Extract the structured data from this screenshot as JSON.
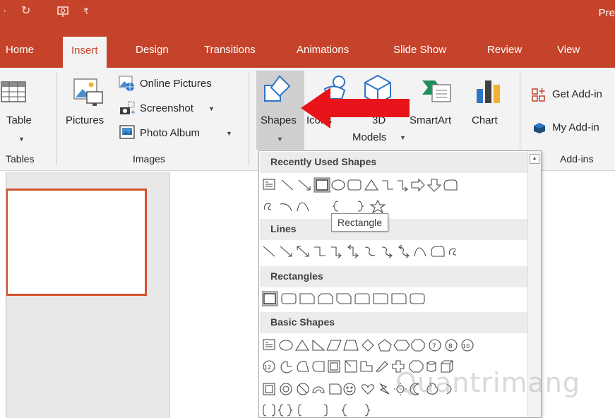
{
  "titlebar": {
    "title": "Pre"
  },
  "tabs": [
    {
      "label": "Home",
      "active": false
    },
    {
      "label": "Insert",
      "active": true
    },
    {
      "label": "Design",
      "active": false
    },
    {
      "label": "Transitions",
      "active": false
    },
    {
      "label": "Animations",
      "active": false
    },
    {
      "label": "Slide Show",
      "active": false
    },
    {
      "label": "Review",
      "active": false
    },
    {
      "label": "View",
      "active": false
    }
  ],
  "ribbon": {
    "tables": {
      "table_label": "Table",
      "group_label": "Tables"
    },
    "images": {
      "pictures_label": "Pictures",
      "online_pictures_label": "Online Pictures",
      "screenshot_label": "Screenshot",
      "photo_album_label": "Photo Album",
      "group_label": "Images"
    },
    "illustrations": {
      "shapes_label": "Shapes",
      "icons_label": "Icons",
      "models_line1": "3D",
      "models_line2": "Models",
      "smartart_label": "SmartArt",
      "chart_label": "Chart"
    },
    "addins": {
      "get_addins_label": "Get Add-in",
      "my_addins_label": "My Add-in",
      "group_label": "Add-ins"
    }
  },
  "gallery": {
    "sections": [
      "Recently Used Shapes",
      "Lines",
      "Rectangles",
      "Basic Shapes"
    ],
    "tooltip": "Rectangle",
    "hovered_shape": "Rectangle"
  },
  "colors": {
    "accent": "#c5432a",
    "arrow": "#e8141b",
    "ribbon_bg": "#f3f3f3"
  },
  "watermark": "Quantrimang"
}
